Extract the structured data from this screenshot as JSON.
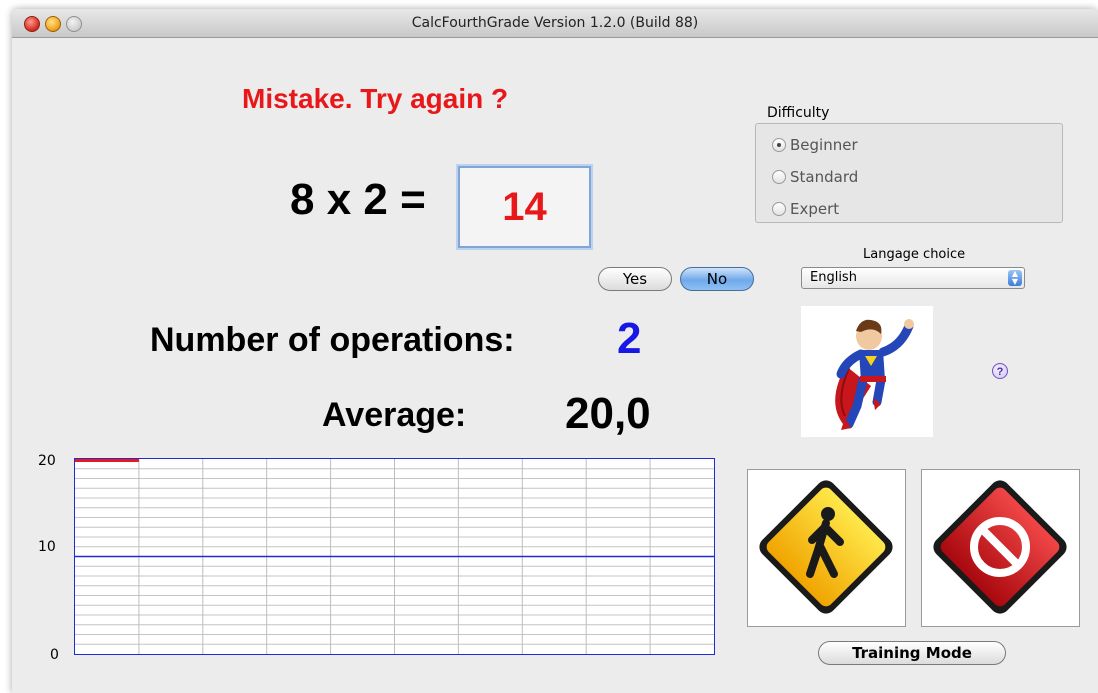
{
  "window": {
    "title": "CalcFourthGrade  Version 1.2.0 (Build 88)"
  },
  "feedback": {
    "message": "Mistake. Try again ?",
    "color": "#e8181a"
  },
  "question": {
    "equation": "8 x 2 =",
    "answer": "14"
  },
  "buttons": {
    "yes": "Yes",
    "no": "No",
    "training_mode": "Training Mode"
  },
  "stats": {
    "operations_label": "Number of operations:",
    "operations_value": "2",
    "average_label": "Average:",
    "average_value": "20,0"
  },
  "difficulty": {
    "title": "Difficulty",
    "options": [
      "Beginner",
      "Standard",
      "Expert"
    ],
    "selected": "Beginner"
  },
  "language": {
    "title": "Langage choice",
    "selected": "English"
  },
  "icons": {
    "hero": "superhero-image",
    "help": "help-icon",
    "go": "walking-man-sign-icon",
    "stop": "stop-sign-icon"
  },
  "chart_data": {
    "type": "line",
    "ylim": [
      0,
      20
    ],
    "yticks": [
      "20",
      "10",
      "0"
    ],
    "series": [
      {
        "values": [
          20,
          20
        ],
        "color": "#e8181a"
      }
    ],
    "reference_line": {
      "value": 10,
      "color": "#1f2bd6"
    },
    "x_divisions": 10
  }
}
